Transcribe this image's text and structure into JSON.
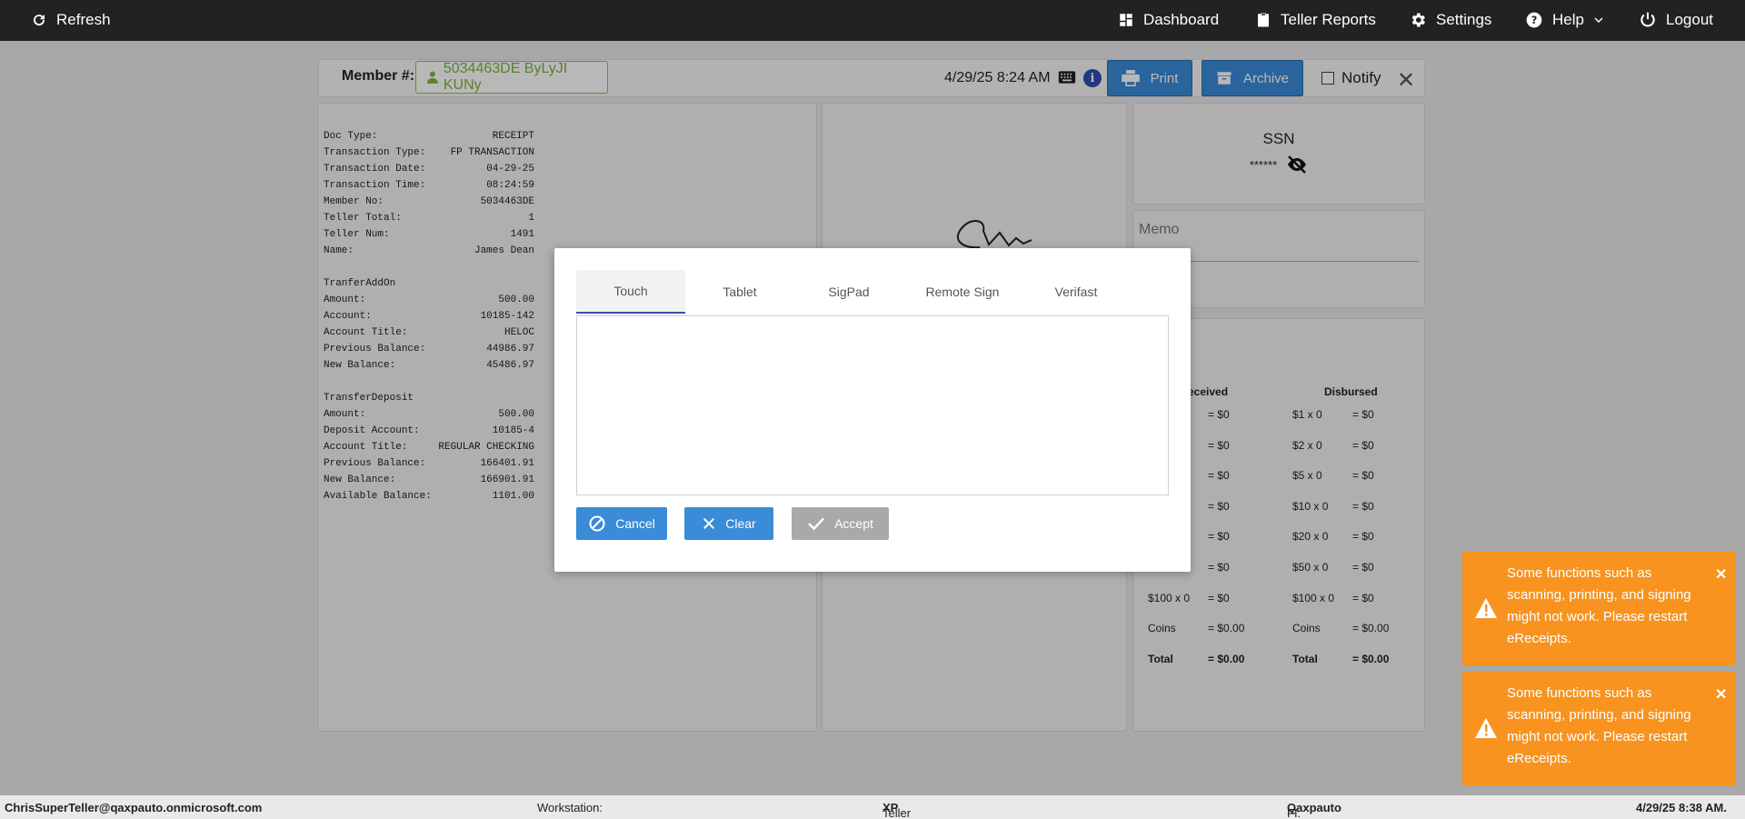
{
  "topbar": {
    "refresh_label": "Refresh",
    "nav": [
      {
        "label": "Dashboard",
        "icon": "dashboard-icon"
      },
      {
        "label": "Teller Reports",
        "icon": "clipboard-icon"
      },
      {
        "label": "Settings",
        "icon": "gear-icon"
      },
      {
        "label": "Help",
        "icon": "help-icon"
      },
      {
        "label": "Logout",
        "icon": "power-icon"
      }
    ]
  },
  "header": {
    "member_label": "Member #:",
    "member_value": "5034463DE ByLyJI KUNy",
    "datetime": "4/29/25 8:24 AM",
    "print_label": "Print",
    "archive_label": "Archive",
    "notify_label": "Notify"
  },
  "receipt": {
    "rows": [
      [
        "Doc Type:",
        "RECEIPT"
      ],
      [
        "Transaction Type:",
        "FP TRANSACTION"
      ],
      [
        "Transaction Date:",
        "04-29-25"
      ],
      [
        "Transaction Time:",
        "08:24:59"
      ],
      [
        "Member No:",
        "5034463DE"
      ],
      [
        "Teller Total:",
        "1"
      ],
      [
        "Teller Num:",
        "1491"
      ],
      [
        "Name:",
        "James Dean"
      ],
      [
        "",
        ""
      ],
      [
        "TranferAddOn",
        ""
      ],
      [
        "Amount:",
        "500.00"
      ],
      [
        "Account:",
        "10185-142"
      ],
      [
        "Account Title:",
        "HELOC"
      ],
      [
        "Previous Balance:",
        "44986.97"
      ],
      [
        "New Balance:",
        "45486.97"
      ],
      [
        "",
        ""
      ],
      [
        "TransferDeposit",
        ""
      ],
      [
        "Amount:",
        "500.00"
      ],
      [
        "Deposit Account:",
        "10185-4"
      ],
      [
        "Account Title:",
        "REGULAR CHECKING"
      ],
      [
        "Previous Balance:",
        "166401.91"
      ],
      [
        "New Balance:",
        "166901.91"
      ],
      [
        "Available Balance:",
        "1101.00"
      ]
    ]
  },
  "ssn": {
    "title": "SSN",
    "value": "******"
  },
  "memo": {
    "placeholder": "Memo"
  },
  "cash": {
    "received_header": "eceived",
    "disbursed_header": "Disbursed",
    "received_rows": [
      [
        "",
        "= $0"
      ],
      [
        "",
        "= $0"
      ],
      [
        "",
        "= $0"
      ],
      [
        "",
        "= $0"
      ],
      [
        "",
        "= $0"
      ],
      [
        "",
        "= $0"
      ],
      [
        "$100 x 0",
        "= $0"
      ],
      [
        "Coins",
        "= $0.00"
      ],
      [
        "Total",
        "= $0.00"
      ]
    ],
    "disbursed_rows": [
      [
        "$1 x 0",
        "= $0"
      ],
      [
        "$2 x 0",
        "= $0"
      ],
      [
        "$5 x 0",
        "= $0"
      ],
      [
        "$10 x 0",
        "= $0"
      ],
      [
        "$20 x 0",
        "= $0"
      ],
      [
        "$50 x 0",
        "= $0"
      ],
      [
        "$100 x 0",
        "= $0"
      ],
      [
        "Coins",
        "= $0.00"
      ],
      [
        "Total",
        "= $0.00"
      ]
    ]
  },
  "modal": {
    "tabs": [
      "Touch",
      "Tablet",
      "SigPad",
      "Remote Sign",
      "Verifast"
    ],
    "active_tab": "Touch",
    "cancel_label": "Cancel",
    "clear_label": "Clear",
    "accept_label": "Accept"
  },
  "toasts": [
    {
      "message": "Some functions such as scanning, printing, and signing might not work. Please restart eReceipts."
    },
    {
      "message": "Some functions such as scanning, printing, and signing might not work. Please restart eReceipts."
    }
  ],
  "footer": {
    "user": "ChrisSuperTeller@qaxpauto.onmicrosoft.com",
    "workstation_label": "Workstation:",
    "platform_label": "Teller Platform:",
    "platform_value": "XP",
    "fi_label": "FI:",
    "fi_value": "Qaxpauto",
    "datetime": "4/29/25 8:38 AM."
  },
  "colors": {
    "topbar": "#222222",
    "primary_button": "#3a8bd8",
    "disabled_button": "#a9a9a9",
    "toast": "#f7931e",
    "member_chip": "#7cb342",
    "active_tab_underline": "#3b4fa8"
  }
}
